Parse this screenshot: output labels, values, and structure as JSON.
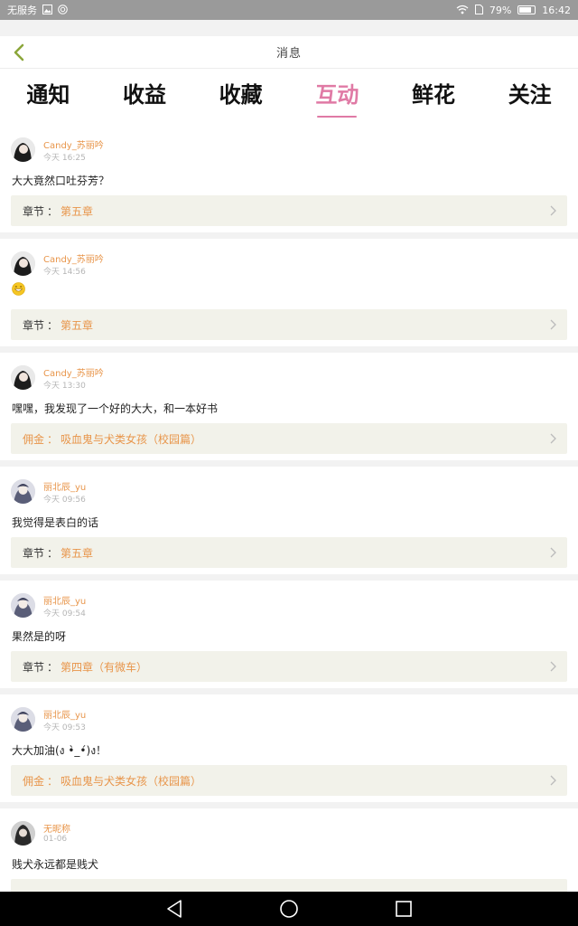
{
  "status_bar": {
    "carrier": "无服务",
    "battery_percent": "79%",
    "battery_level": 0.79,
    "time": "16:42"
  },
  "header": {
    "title": "消息"
  },
  "tabs": [
    {
      "label": "通知",
      "active": false
    },
    {
      "label": "收益",
      "active": false
    },
    {
      "label": "收藏",
      "active": false
    },
    {
      "label": "互动",
      "active": true
    },
    {
      "label": "鲜花",
      "active": false
    },
    {
      "label": "关注",
      "active": false
    }
  ],
  "comments": [
    {
      "user": "Candy_苏丽吟",
      "time": "今天 16:25",
      "text": "大大竟然口吐芬芳？",
      "ref_label": "章节",
      "ref_value": "第五章"
    },
    {
      "user": "Candy_苏丽吟",
      "time": "今天 14:56",
      "text": "",
      "emoji": "grin-emoji",
      "ref_label": "章节",
      "ref_value": "第五章"
    },
    {
      "user": "Candy_苏丽吟",
      "time": "今天 13:30",
      "text": "嘿嘿，我发现了一个好的大大，和一本好书",
      "ref_label": "佣金",
      "ref_value": "吸血鬼与犬类女孩（校园篇）"
    },
    {
      "user": "丽北辰_yu",
      "time": "今天 09:56",
      "text": "我觉得是表白的话",
      "ref_label": "章节",
      "ref_value": "第五章"
    },
    {
      "user": "丽北辰_yu",
      "time": "今天 09:54",
      "text": "果然是的呀",
      "ref_label": "章节",
      "ref_value": "第四章（有微车）"
    },
    {
      "user": "丽北辰_yu",
      "time": "今天 09:53",
      "text": "大大加油(ง •̀_•́)ง！",
      "ref_label": "佣金",
      "ref_value": "吸血鬼与犬类女孩（校园篇）"
    },
    {
      "user": "无昵称",
      "time": "01-06",
      "text": "贱犬永远都是贱犬",
      "ref_label": "",
      "ref_value": ""
    }
  ],
  "colors": {
    "accent": "#e07aa5",
    "username": "#e8954a",
    "ref_bg": "#f2f2ea"
  }
}
